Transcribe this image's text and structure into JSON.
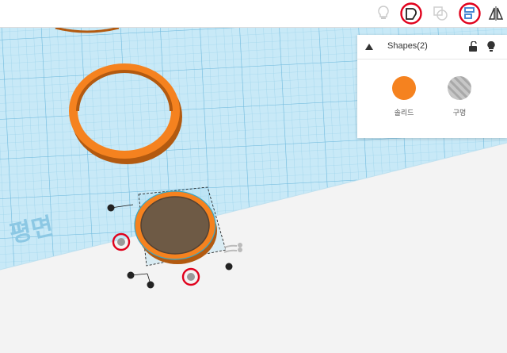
{
  "shapes_panel": {
    "title": "Shapes(2)",
    "solid_label": "솔리드",
    "hole_label": "구멍",
    "solid_color": "#f5821f"
  },
  "workplane": {
    "label": "평면",
    "grid_color": "#bfe5f5"
  },
  "toolbar": {
    "icons": [
      "lightbulb-icon",
      "group-icon",
      "ungroup-icon",
      "align-icon",
      "mirror-icon"
    ],
    "highlighted": [
      "group-icon",
      "align-icon"
    ]
  },
  "annotations": {
    "marker_color": "#e0001b"
  }
}
